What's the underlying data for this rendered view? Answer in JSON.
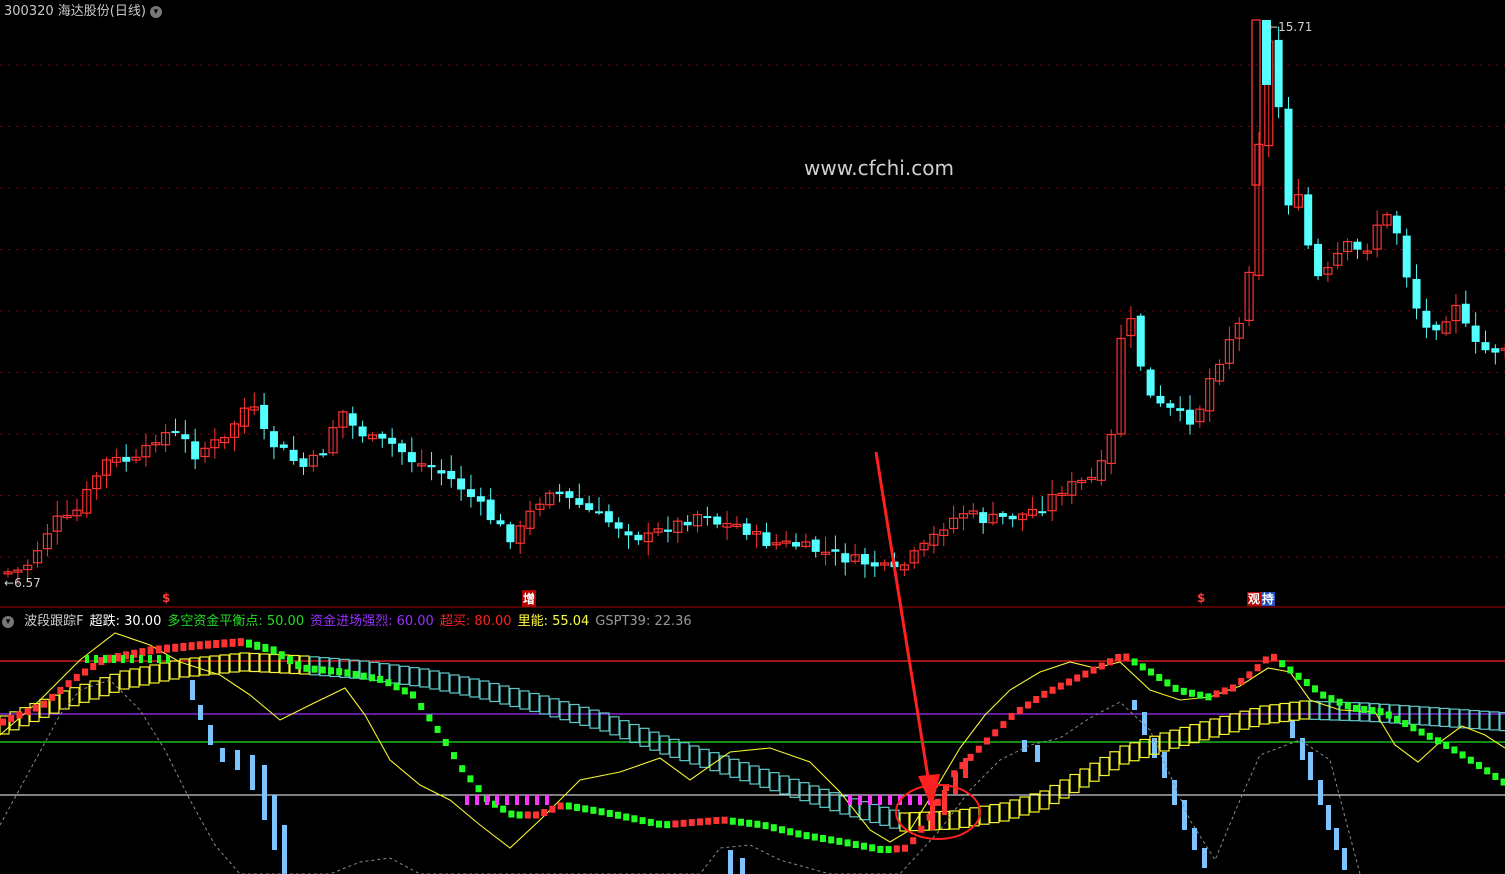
{
  "header": {
    "stock_title": "300320 海达股份(日线)",
    "dropdown_icon": "chevron-down-icon"
  },
  "watermark": "www.cfchi.com",
  "price_labels": {
    "high": "15.71",
    "low": "6.57"
  },
  "signal_marks": [
    {
      "text": "$",
      "color": "#ff3b3b"
    },
    {
      "text": "增",
      "color": "#ffffff",
      "bg": "#b00000"
    },
    {
      "text": "$",
      "color": "#ff3b3b"
    },
    {
      "text": "观",
      "color": "#ffffff",
      "bg": "#b00000"
    },
    {
      "text": "持",
      "color": "#ffffff",
      "bg": "#2050c0"
    }
  ],
  "indicator": {
    "name": "波段跟踪F",
    "items": [
      {
        "label": "超跌:",
        "value": "30.00",
        "color": "#ffffff"
      },
      {
        "label": "多空资金平衡点:",
        "value": "50.00",
        "color": "#22dd22"
      },
      {
        "label": "资金进场强烈:",
        "value": "60.00",
        "color": "#9b30ff"
      },
      {
        "label": "超买:",
        "value": "80.00",
        "color": "#ff2222"
      },
      {
        "label": "里能:",
        "value": "55.04",
        "color": "#ffff44"
      },
      {
        "label": "GSPT39:",
        "value": "22.36",
        "color": "#999999"
      }
    ]
  },
  "colors": {
    "up": "#ff3333",
    "down": "#54ffff",
    "grid": "#8b0000",
    "yellow": "#f5f530",
    "cyan_box": "#5ec8c8",
    "bar_blue": "#7cc4ff",
    "purple_line": "#9b30ff",
    "green_line": "#22dd22",
    "red_line": "#ff2222",
    "white_line": "#ffffff",
    "magenta": "#ff33ff",
    "green_dot": "#22ff22",
    "arrow": "#ff2020"
  },
  "chart_data": {
    "type": "candlestick",
    "price_high": 15.71,
    "price_low": 6.57,
    "oscillator_levels": [
      30,
      50,
      60,
      80
    ]
  }
}
